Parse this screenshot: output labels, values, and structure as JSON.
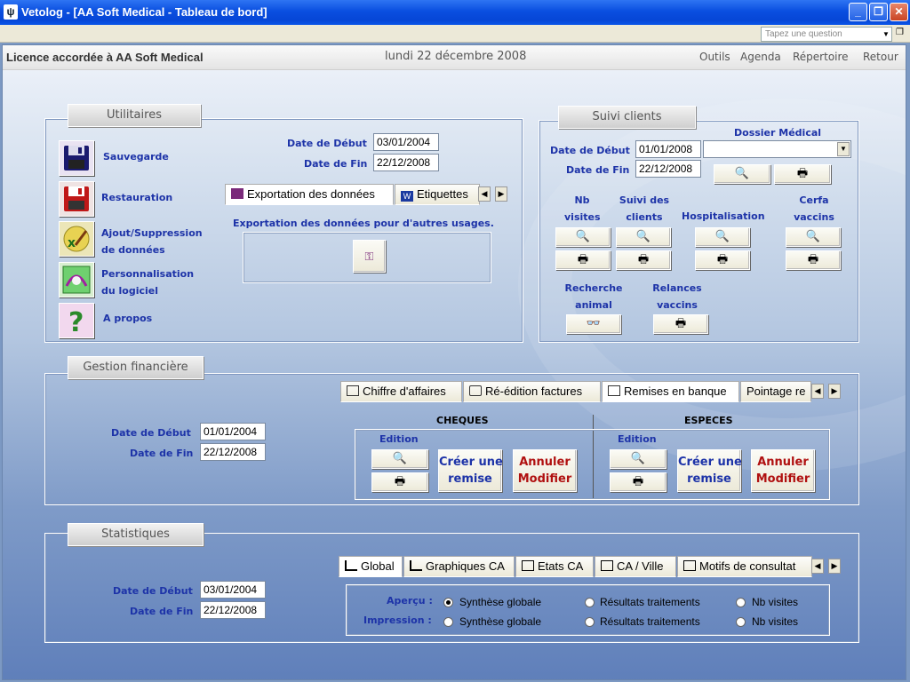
{
  "window": {
    "title": "Vetolog - [AA Soft Medical - Tableau de bord]",
    "icon": "paw-icon",
    "buttons": [
      "minimize",
      "restore",
      "close"
    ]
  },
  "menubar": {
    "ask_placeholder": "Tapez une question"
  },
  "header": {
    "licence": "Licence accordée à  AA Soft Medical",
    "date": "lundi 22 décembre 2008",
    "nav": [
      "Outils",
      "Agenda",
      "Répertoire",
      "Retour"
    ]
  },
  "utilitaires": {
    "title": "Utilitaires",
    "items": [
      "Sauvegarde",
      "Restauration",
      "Ajout/Suppression",
      "de données",
      "Personnalisation",
      "du logiciel",
      "A propos"
    ],
    "date_debut_label": "Date de Début",
    "date_debut": "03/01/2004",
    "date_fin_label": "Date de Fin",
    "date_fin": "22/12/2008",
    "tabs": [
      "Exportation des données",
      "Etiquettes"
    ],
    "export_text": "Exportation des données pour d'autres usages."
  },
  "suivi": {
    "title": "Suivi clients",
    "dossier_label": "Dossier Médical",
    "date_debut_label": "Date de Début",
    "date_debut": "01/01/2008",
    "date_fin_label": "Date de Fin",
    "date_fin": "22/12/2008",
    "cols": [
      "Nb",
      "visites",
      "Suivi des",
      "clients",
      "Hospitalisation",
      "Cerfa",
      "vaccins"
    ],
    "recherche": [
      "Recherche",
      "animal"
    ],
    "relances": [
      "Relances",
      "vaccins"
    ]
  },
  "gestion": {
    "title": "Gestion financière",
    "tabs": [
      "Chiffre d'affaires",
      "Ré-édition factures",
      "Remises en banque",
      "Pointage re"
    ],
    "date_debut_label": "Date de Début",
    "date_debut": "01/01/2004",
    "date_fin_label": "Date de Fin",
    "date_fin": "22/12/2008",
    "cheques": "CHEQUES",
    "especes": "ESPECES",
    "edition": "Edition",
    "creer": [
      "Créer une",
      "remise"
    ],
    "annuler": [
      "Annuler",
      "Modifier"
    ]
  },
  "stats": {
    "title": "Statistiques",
    "tabs": [
      "Global",
      "Graphiques CA",
      "Etats CA",
      "CA / Ville",
      "Motifs de consultat"
    ],
    "date_debut_label": "Date de Début",
    "date_debut": "03/01/2004",
    "date_fin_label": "Date de Fin",
    "date_fin": "22/12/2008",
    "apercu": "Aperçu  :",
    "impression": "Impression  :",
    "options": [
      "Synthèse globale",
      "Résultats traitements",
      "Nb visites"
    ]
  },
  "colors": {
    "label_blue": "#1d33a8",
    "red": "#b01010",
    "title_bar": "#0a4fe0"
  }
}
